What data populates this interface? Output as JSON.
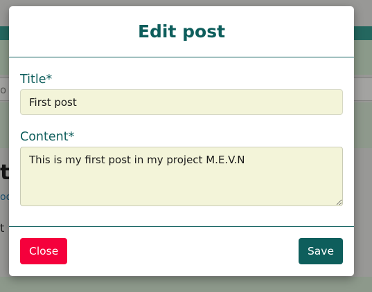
{
  "colors": {
    "accent": "#0e5e5c",
    "danger": "#f5003c",
    "input_bg": "#f3f4d9",
    "overlay_bg": "#989896"
  },
  "modal": {
    "title": "Edit post",
    "fields": {
      "title": {
        "label": "Title*",
        "value": "First post"
      },
      "content": {
        "label": "Content*",
        "value": "This is my first post in my project M.E.V.N"
      }
    },
    "footer": {
      "close_label": "Close",
      "save_label": "Save"
    }
  },
  "background": {
    "input_fragment": "o",
    "heading_fragment": "t",
    "link_fragment": "oo",
    "text_fragment": "t"
  }
}
